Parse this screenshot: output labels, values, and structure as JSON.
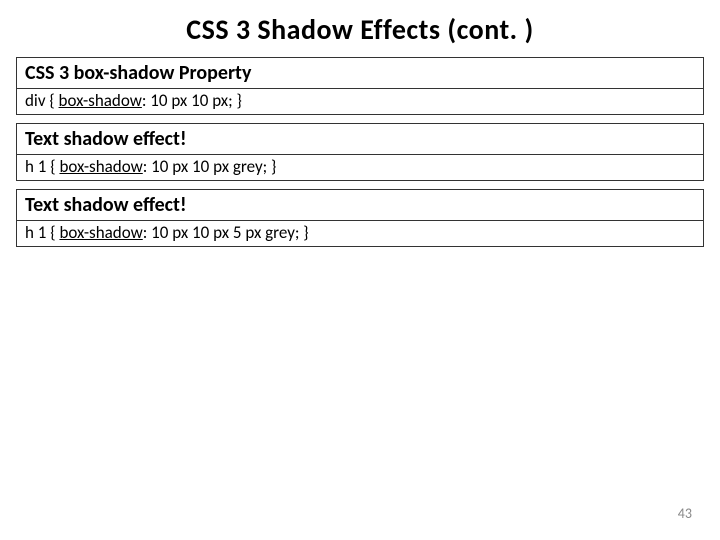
{
  "title": "CSS 3 Shadow Effects (cont. )",
  "sections": [
    {
      "heading": "CSS 3 box-shadow Property",
      "code_prefix": "div { ",
      "code_property": "box-shadow",
      "code_suffix": ": 10 px 10 px; }"
    },
    {
      "heading": "Text shadow effect!",
      "code_prefix": "h 1 { ",
      "code_property": "box-shadow",
      "code_suffix": ": 10 px 10 px grey; }"
    },
    {
      "heading": "Text shadow effect!",
      "code_prefix": "h 1 { ",
      "code_property": "box-shadow",
      "code_suffix": ": 10 px 10 px 5 px grey; }"
    }
  ],
  "page_number": "43"
}
